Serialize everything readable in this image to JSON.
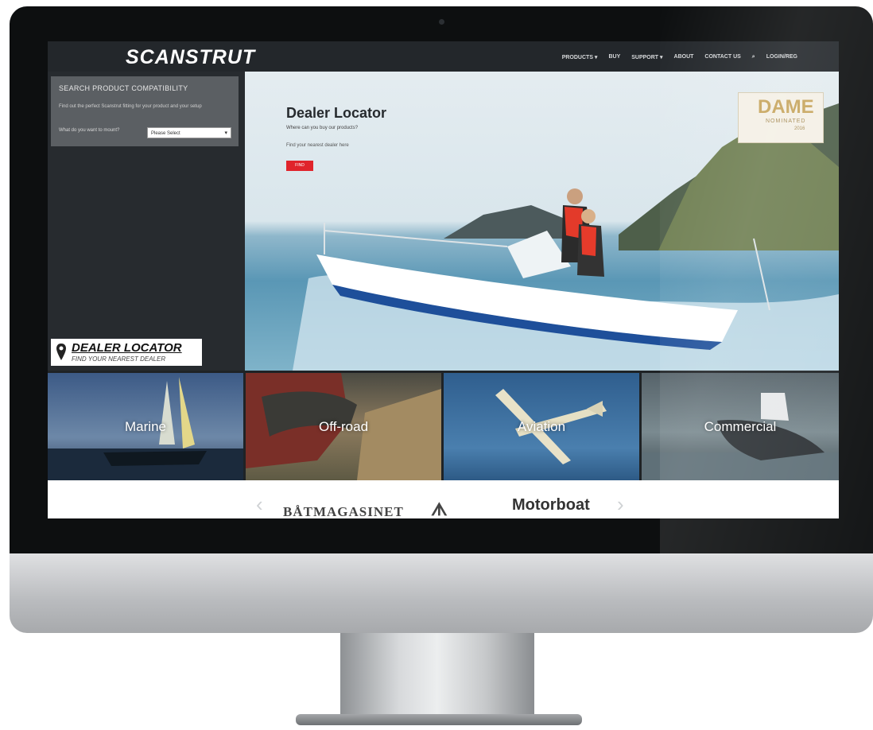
{
  "nav": {
    "logo": "SCANSTRUT",
    "items": [
      "PRODUCTS ▾",
      "BUY",
      "SUPPORT ▾",
      "ABOUT",
      "CONTACT US",
      "⌕",
      "LOGIN/REG"
    ]
  },
  "sidebar": {
    "title": "SEARCH PRODUCT COMPATIBILITY",
    "description": "Find out the perfect Scanstrut fitting for your product and your setup",
    "question": "What do you want to mount?",
    "select": "Please Select",
    "dealer_logo": {
      "main": "DEALER LOCATOR",
      "sub": "FIND YOUR NEAREST DEALER"
    }
  },
  "hero": {
    "title": "Dealer Locator",
    "subtitle": "Where can you buy our products?",
    "subtitle2": "Find your nearest dealer here",
    "button": "FIND",
    "badge": {
      "main": "DAME",
      "sub": "NOMINATED",
      "year": "2016"
    }
  },
  "categories": [
    "Marine",
    "Off-road",
    "Aviation",
    "Commercial"
  ],
  "brands": [
    "BÅTMAGASINET",
    "ᗑ",
    "Motorboat"
  ],
  "colors": {
    "accent_red": "#e0242b",
    "nav_bg": "#23272b",
    "badge_gold": "#c7a55d"
  }
}
